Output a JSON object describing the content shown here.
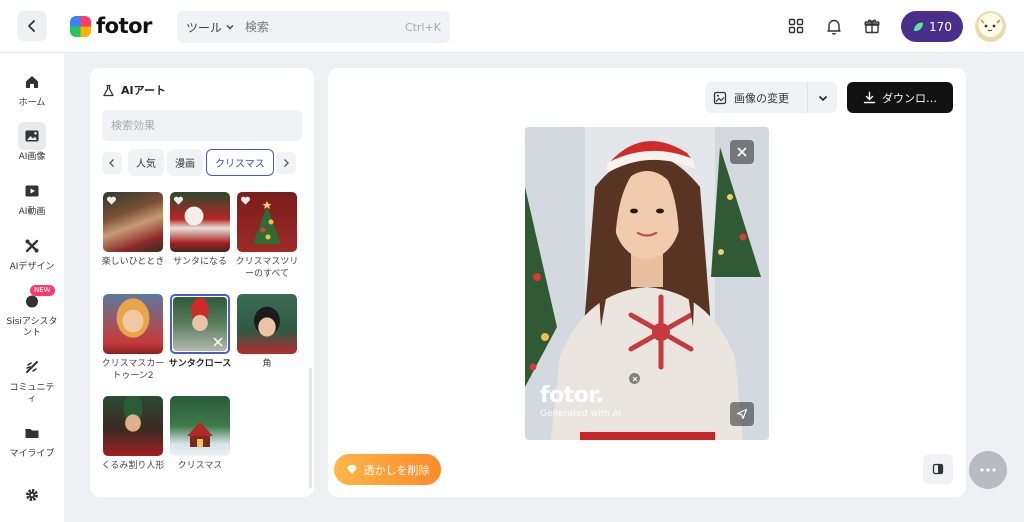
{
  "topbar": {
    "brand": "fotor",
    "search": {
      "tool_label": "ツール",
      "placeholder": "検索",
      "shortcut": "Ctrl+K"
    },
    "credits": "170"
  },
  "sidenav": {
    "items": [
      {
        "label": "ホーム",
        "icon": "home-icon"
      },
      {
        "label": "AI画像",
        "icon": "ai-image-icon"
      },
      {
        "label": "AI動画",
        "icon": "ai-video-icon"
      },
      {
        "label": "AIデザイン",
        "icon": "ai-design-icon"
      },
      {
        "label": "Sisiアシスタント",
        "icon": "sisi-assistant-icon",
        "badge": "NEW"
      },
      {
        "label": "コミュニティ",
        "icon": "community-icon"
      },
      {
        "label": "マイライブ",
        "icon": "folder-icon"
      }
    ]
  },
  "panel": {
    "title": "AIアート",
    "search_placeholder": "検索効果",
    "tabs": [
      "人気",
      "漫画",
      "クリスマス"
    ],
    "thumbnails": [
      {
        "label": "楽しいひととき"
      },
      {
        "label": "サンタになる"
      },
      {
        "label": "クリスマスツリーのすべて"
      },
      {
        "label": "クリスマスカートゥーン2"
      },
      {
        "label": "サンタクロース"
      },
      {
        "label": "角"
      },
      {
        "label": "くるみ割り人形"
      },
      {
        "label": "クリスマス"
      }
    ]
  },
  "canvas": {
    "change_image_label": "画像の変更",
    "download_label": "ダウンロ…",
    "watermark_brand": "fotor.",
    "watermark_sub": "Generated with AI",
    "remove_watermark_label": "透かしを削除"
  },
  "colors": {
    "accent": "#4a5bd8",
    "credits_bg": "#4a2f8a",
    "download_bg": "#111111",
    "remove_wm_gradient": [
      "#ffb648",
      "#ff8a2a"
    ],
    "new_badge": "#ff3b6b"
  }
}
